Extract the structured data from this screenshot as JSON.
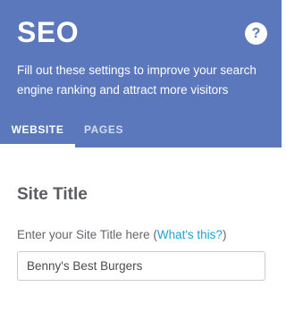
{
  "header": {
    "title": "SEO",
    "help_icon": "question-mark-icon",
    "help_glyph": "?",
    "description": "Fill out these settings to improve your search engine ranking and attract more visitors",
    "background_color": "#5a78bb"
  },
  "tabs": [
    {
      "label": "WEBSITE",
      "active": true
    },
    {
      "label": "PAGES",
      "active": false
    }
  ],
  "site_title_section": {
    "heading": "Site Title",
    "label_prefix": "Enter your Site Title here (",
    "help_link": "What's this?",
    "label_suffix": ")",
    "input_value": "Benny's Best Burgers",
    "link_color": "#1ba3d6"
  }
}
